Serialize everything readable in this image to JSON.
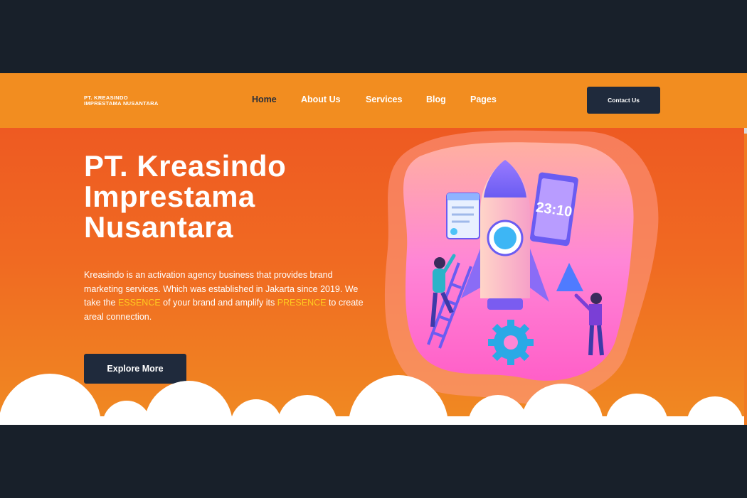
{
  "brand": {
    "line1": "PT. KREASINDO",
    "line2": "IMPRESTAMA NUSANTARA"
  },
  "nav": {
    "items": [
      {
        "label": "Home",
        "active": true
      },
      {
        "label": "About Us",
        "active": false
      },
      {
        "label": "Services",
        "active": false
      },
      {
        "label": "Blog",
        "active": false
      },
      {
        "label": "Pages",
        "active": false
      }
    ],
    "contact_label": "Contact Us"
  },
  "hero": {
    "title_lines": [
      "PT. Kreasindo",
      "Imprestama",
      "Nusantara"
    ],
    "desc_before": "Kreasindo is an activation agency business that provides brand marketing services. Which was established in Jakarta since 2019. We take the ",
    "highlight1": "ESSENCE",
    "desc_middle": " of your brand and amplify its ",
    "highlight2": "PRESENCE",
    "desc_after": " to create areal connection.",
    "button_label": "Explore More",
    "clock_text": "23:10"
  },
  "colors": {
    "page_bg": "#18202a",
    "navbar": "#f28d20",
    "hero_top": "#ee5a22",
    "hero_bottom": "#f08a22",
    "button": "#1f2a3c",
    "highlight": "#ffcc1f",
    "blob": "#ff7fd0"
  },
  "icons": [
    "rocket-icon",
    "gear-icon",
    "clock-screen-icon",
    "browser-window-icon"
  ]
}
